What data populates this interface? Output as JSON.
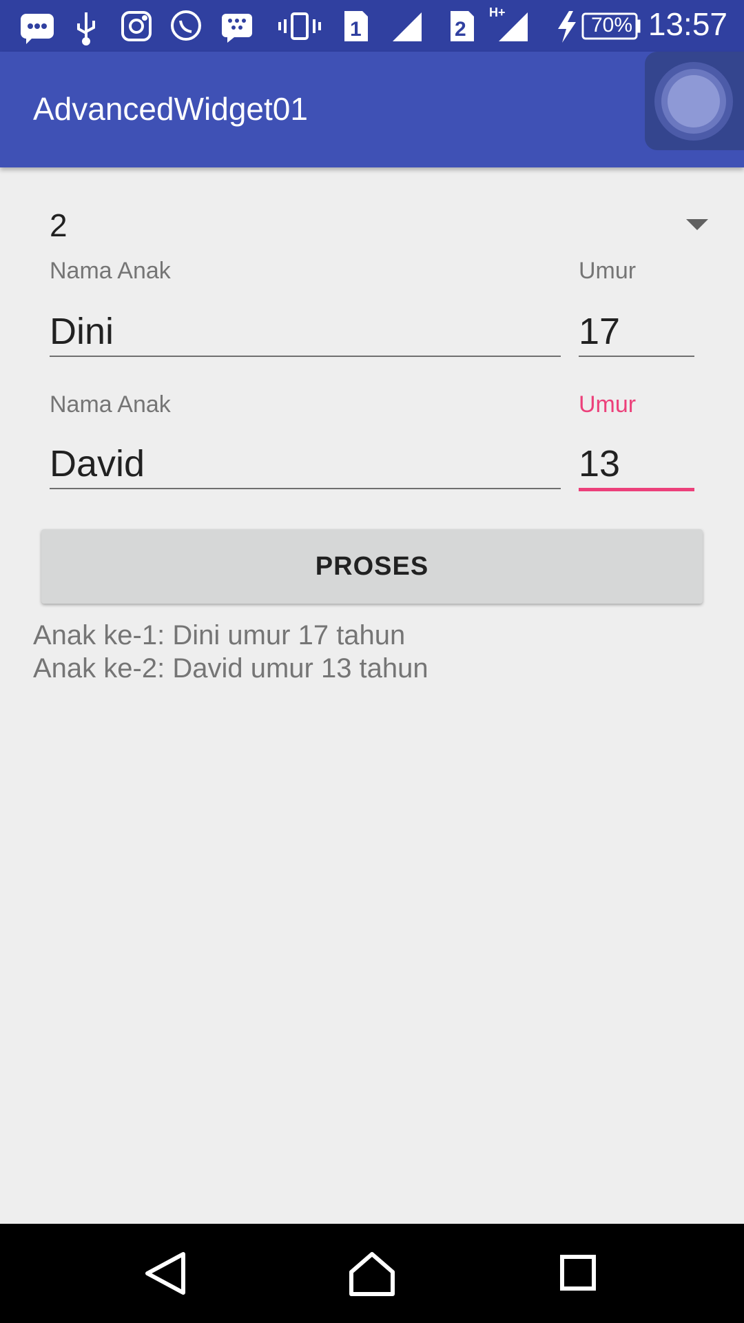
{
  "status_bar": {
    "time": "13:57",
    "battery": "70%",
    "sim1": "1",
    "sim2": "2",
    "network": "H+",
    "icons": [
      "message-icon",
      "usb-icon",
      "instagram-icon",
      "whatsapp-icon",
      "bbm-icon",
      "vibrate-icon",
      "sim1-icon",
      "signal-icon",
      "sim2-icon",
      "signal-hplus-icon",
      "charging-icon",
      "battery-icon"
    ]
  },
  "app_bar": {
    "title": "AdvancedWidget01"
  },
  "spinner": {
    "selected": "2"
  },
  "children": [
    {
      "name_label": "Nama Anak",
      "name_value": "Dini",
      "age_label": "Umur",
      "age_value": "17"
    },
    {
      "name_label": "Nama Anak",
      "name_value": "David",
      "age_label": "Umur",
      "age_value": "13"
    }
  ],
  "process_button": {
    "label": "PROSES"
  },
  "results": [
    "Anak ke-1: Dini umur 17 tahun",
    "Anak ke-2: David umur 13 tahun"
  ],
  "colors": {
    "status_bar": "#3040a0",
    "app_bar": "#3f51b5",
    "accent": "#ec407a",
    "background": "#eeeeee"
  }
}
